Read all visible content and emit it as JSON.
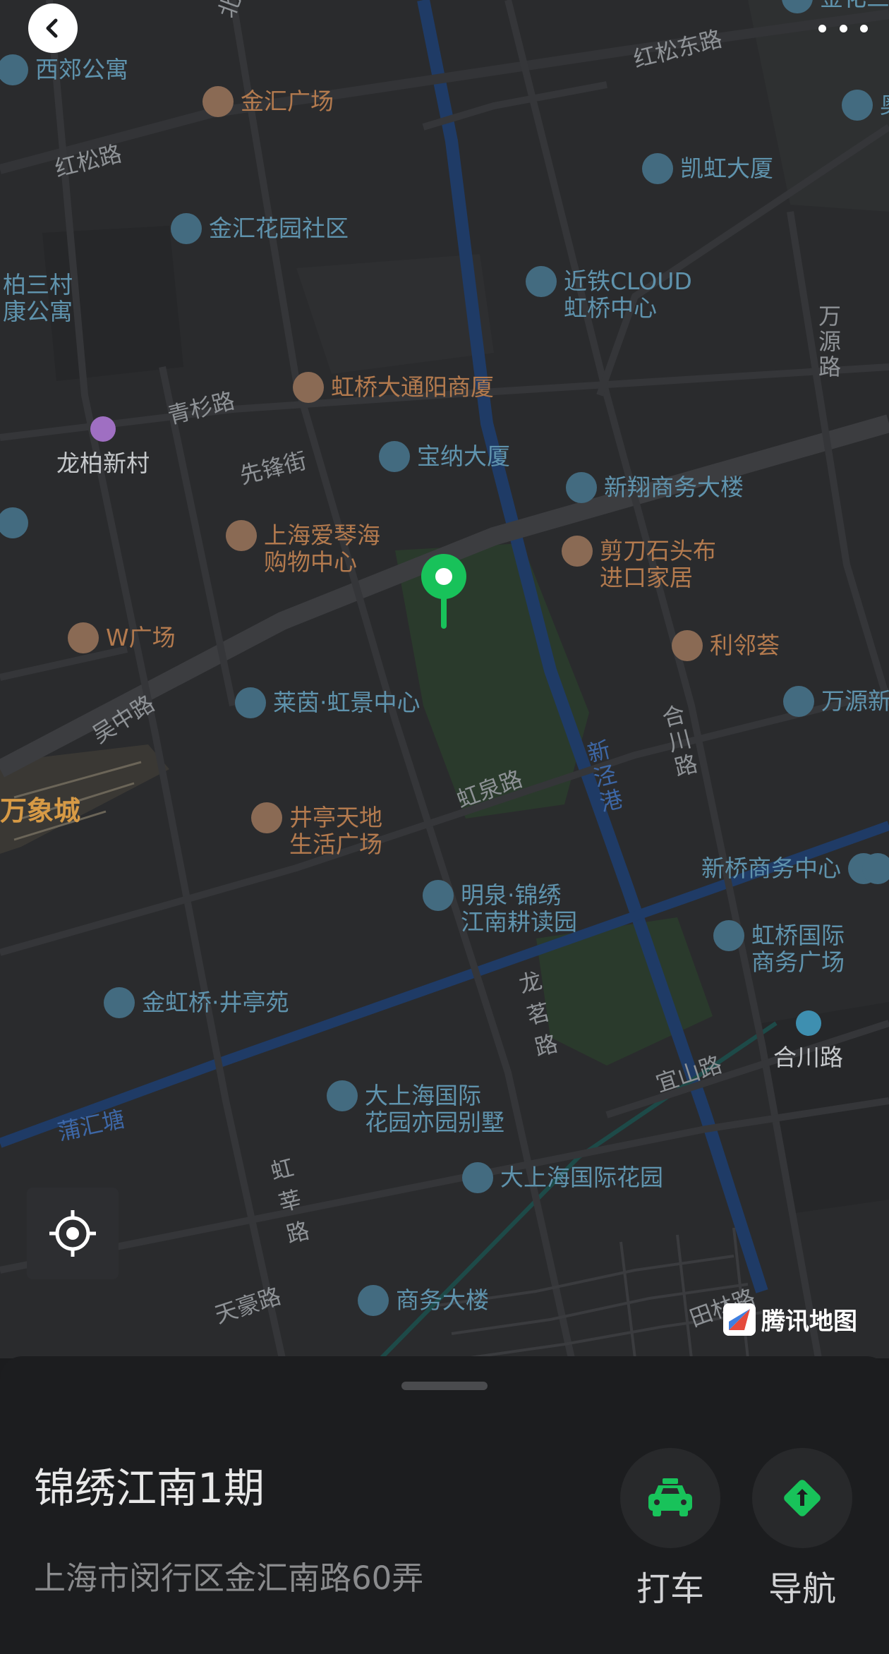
{
  "header": {
    "back": "back-icon",
    "more": "more-icon"
  },
  "map": {
    "pois_building": [
      {
        "text": [
          "西郊公寓"
        ]
      },
      {
        "text": [
          "凯虹大厦"
        ]
      },
      {
        "text": [
          "金汇花园社区"
        ]
      },
      {
        "text": [
          "近铁CLOUD",
          "虹桥中心"
        ]
      },
      {
        "text": [
          "宝纳大厦"
        ]
      },
      {
        "text": [
          "新翔商务大楼"
        ]
      },
      {
        "text": [
          "莱茵·虹景中心"
        ]
      },
      {
        "text": [
          "万源新"
        ]
      },
      {
        "text": [
          "新桥商务中心"
        ]
      },
      {
        "text": [
          "明泉·锦绣",
          "江南耕读园"
        ]
      },
      {
        "text": [
          "虹桥国际",
          "商务广场"
        ]
      },
      {
        "text": [
          "金虹桥·井亭苑"
        ]
      },
      {
        "text": [
          "大上海国际",
          "花园亦园别墅"
        ]
      },
      {
        "text": [
          "大上海国际花园"
        ]
      },
      {
        "text": [
          "商务大楼"
        ]
      },
      {
        "text": [
          "柏三村",
          "康公寓"
        ]
      },
      {
        "text": [
          "奥"
        ]
      },
      {
        "text": [
          "金化三"
        ]
      }
    ],
    "pois_shop": [
      {
        "text": [
          "金汇广场"
        ]
      },
      {
        "text": [
          "虹桥大通阳商厦"
        ]
      },
      {
        "text": [
          "上海爱琴海",
          "购物中心"
        ]
      },
      {
        "text": [
          "剪刀石头布",
          "进口家居"
        ]
      },
      {
        "text": [
          "W广场"
        ]
      },
      {
        "text": [
          "利邻荟"
        ]
      },
      {
        "text": [
          "井亭天地",
          "生活广场"
        ]
      }
    ],
    "roads": [
      "红松东路",
      "红松路",
      "青杉路",
      "先锋街",
      "吴中路",
      "虹泉路",
      "龙茗路",
      "宜山路",
      "虹莘路",
      "天豪路",
      "田林路",
      "万源路",
      "合川路"
    ],
    "water": [
      "新泾港",
      "蒲汇塘"
    ],
    "stations": [
      "龙柏新村",
      "合川路"
    ],
    "area": "万象城",
    "partial_road": "北路",
    "logo": "腾讯地图"
  },
  "sheet": {
    "name": "锦绣江南1期",
    "address": "上海市闵行区金汇南路60弄",
    "actions": {
      "taxi": {
        "label": "打车",
        "icon": "taxi-icon"
      },
      "nav": {
        "label": "导航",
        "icon": "navigation-icon"
      }
    }
  },
  "colors": {
    "accent": "#18c25a",
    "poi_building": "#5f93ad",
    "poi_shop": "#b37a4e",
    "water": "#1f3b66"
  }
}
